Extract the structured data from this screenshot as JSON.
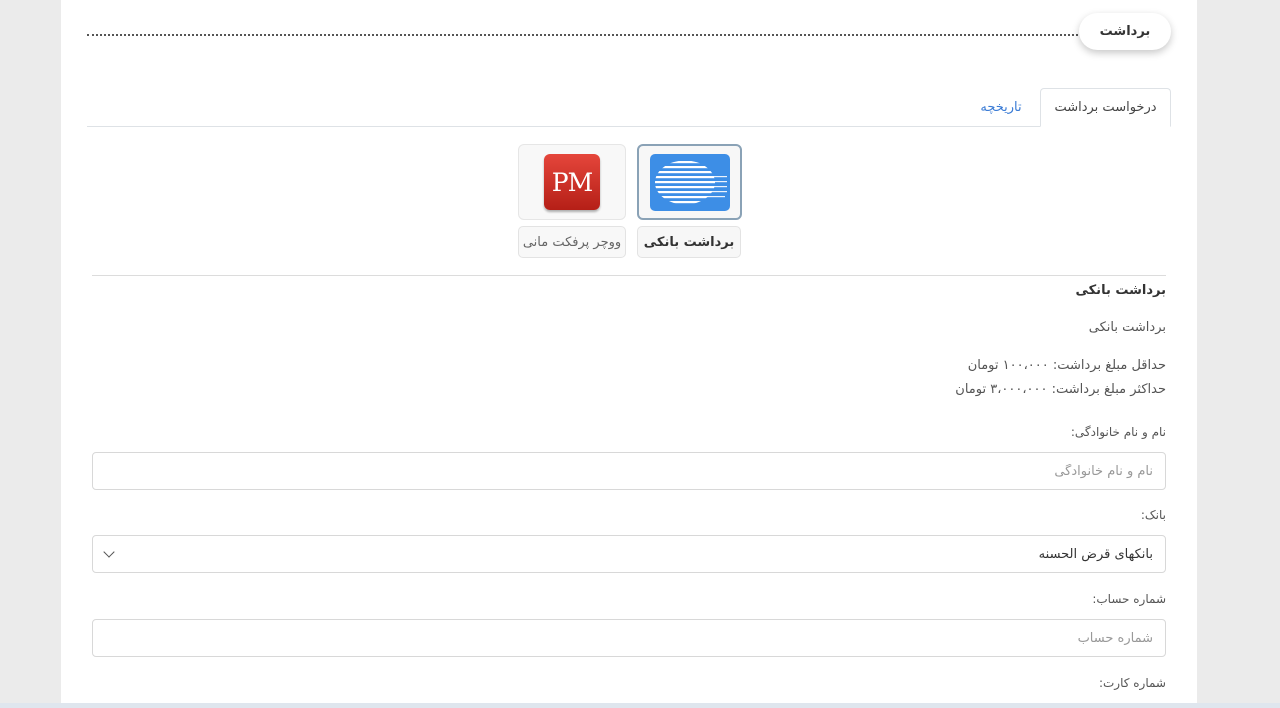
{
  "page": {
    "title": "برداشت"
  },
  "tabs": [
    {
      "label": "درخواست برداشت",
      "active": true
    },
    {
      "label": "تاریخچه",
      "active": false
    }
  ],
  "methods": [
    {
      "label": "برداشت بانکی",
      "icon": "bank-icon",
      "selected": true
    },
    {
      "label": "ووچر پرفکت مانی",
      "icon": "perfect-money-icon",
      "logo_text": "PM",
      "selected": false
    }
  ],
  "details": {
    "heading": "برداشت بانکی",
    "description": "برداشت بانکی",
    "min_amount": "حداقل مبلغ برداشت: ۱۰۰،۰۰۰ تومان",
    "max_amount": "حداکثر مبلغ برداشت: ۳،۰۰۰،۰۰۰ تومان"
  },
  "form": {
    "name": {
      "label": "نام و نام خانوادگی:",
      "placeholder": "نام و نام خانوادگی",
      "value": ""
    },
    "bank": {
      "label": "بانک:",
      "selected": "بانکهای قرض الحسنه"
    },
    "account": {
      "label": "شماره حساب:",
      "placeholder": "شماره حساب",
      "value": ""
    },
    "card": {
      "label": "شماره کارت:"
    }
  },
  "colors": {
    "accent_link": "#3a7bd5",
    "bank_logo_blue": "#3d8ee6",
    "pm_red": "#d0342a"
  }
}
